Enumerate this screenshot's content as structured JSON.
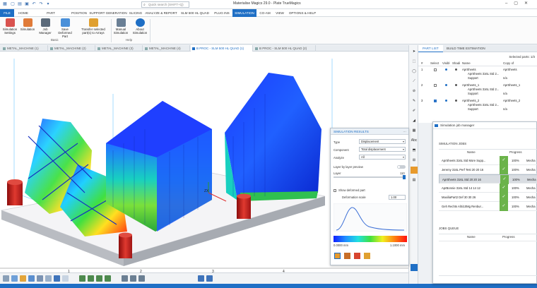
{
  "window": {
    "title": "Materialise Magics 29.0 - Plate TrueMagics",
    "search_placeholder": "Quick search (SHIFT+Q)"
  },
  "ribbon_tabs": [
    "FILE",
    "HOME",
    "PART REPRESENTATION",
    "POSITION",
    "SUPPORT GENERATION",
    "SLICING",
    "ANALYZE & REPORT",
    "SLM 500 HL QUAD",
    "PLUG INS",
    "SIMULATION",
    "CO-AM",
    "VIEW",
    "OPTIONS & HELP"
  ],
  "ribbon_active": "SIMULATION",
  "ribbon": {
    "buttons": [
      {
        "label": "Simulation Settings",
        "icon": "settings-icon",
        "color": "#d9534f"
      },
      {
        "label": "Simulation",
        "icon": "simulation-cube-icon",
        "color": "#e07b39"
      },
      {
        "label": "Job Manager",
        "icon": "job-manager-icon",
        "color": "#5b6a7a"
      },
      {
        "label": "Save Deformed Part",
        "icon": "save-deformed-icon",
        "color": "#4a90d9"
      },
      {
        "label": "Transfer selected part(s) to Arrays",
        "icon": "transfer-icon",
        "color": "#e0a030"
      },
      {
        "label": "Manual Simulation",
        "icon": "manual-icon",
        "color": "#6a7f95"
      },
      {
        "label": "About Simulation",
        "icon": "info-icon",
        "color": "#1f6fc5"
      }
    ],
    "groups": [
      "Basic",
      "Help"
    ]
  },
  "doc_tabs": [
    "METAL_MACHINE (1)",
    "METAL_MACHINE (2)",
    "METAL_MACHINE (3)",
    "METAL_MACHINE (4)",
    "B PROC - SLM 500 HL QUAD (1)",
    "B PROC - SLM 500 HL QUAD (2)"
  ],
  "doc_tab_active": 4,
  "part_panel": {
    "tabs": [
      "PART LIST",
      "BUILD TIME ESTIMATION"
    ],
    "selected_parts": "Selected parts: 1/3",
    "headers": [
      "#",
      "Select",
      "Visibl",
      "Shadi",
      "Name",
      "Copy of"
    ],
    "rows": [
      {
        "num": "1",
        "selected": false,
        "name": "AprSheets",
        "sub": "AprSheets 316L Std 2...",
        "sub2": "Support",
        "copy": "AprSheets",
        "copy2": "n/a"
      },
      {
        "num": "2",
        "selected": false,
        "name": "AprSheets_1",
        "sub": "AprSheets 316L Std 2...",
        "sub2": "Support",
        "copy": "AprSheets_1",
        "copy2": "n/a"
      },
      {
        "num": "3",
        "selected": true,
        "name": "AprSheets_2",
        "sub": "AprSheets 316L Std 2...",
        "sub2": "Support",
        "copy": "AprSheets_2",
        "copy2": "n/a"
      }
    ]
  },
  "sim_results": {
    "title": "SIMULATION RESULTS",
    "type_label": "Type",
    "type_value": "Displacement",
    "component_label": "Component",
    "component_value": "Total displacement",
    "analyze_label": "Analyze",
    "analyze_value": "All",
    "layer_preview_label": "Layer by layer preview",
    "layer_label": "Layer",
    "layer_value": "110",
    "show_deformed_label": "Show deformed part",
    "deformation_scale_label": "Deformation scale",
    "deformation_scale_value": "1.00",
    "scale_min": "0.0000 mm",
    "scale_max": "1.1000 mm"
  },
  "job_manager": {
    "title": "Simulation job manager",
    "jobs_label": "SIMULATION JOBS",
    "queue_label": "JOBS QUEUE",
    "col_name": "Name",
    "col_progress": "Progress",
    "jobs": [
      {
        "name": "AprSheets 316L Std More Supp...",
        "progress": "100%",
        "machine": "Mecha"
      },
      {
        "name": "Jeremy 316L Perf Test 20 20 16",
        "progress": "100%",
        "machine": "Mecha"
      },
      {
        "name": "AprSheets 316L Std 20 20 16",
        "progress": "100%",
        "machine": "Mecha"
      },
      {
        "name": "AprBonnie 316L Std 14 14 12",
        "progress": "100%",
        "machine": "Mecha"
      },
      {
        "name": "MaxiliaPart2 Def 30 30 26",
        "progress": "100%",
        "machine": "Mecha"
      },
      {
        "name": "Geh Rechts AlSi10Mg Renbur...",
        "progress": "100%",
        "machine": "Mecha"
      }
    ],
    "selected_job": 2
  },
  "viewport": {
    "ruler": [
      "1",
      "2",
      "3",
      "4"
    ],
    "axis_label": "ZX"
  },
  "colors": {
    "accent": "#1f6fc5",
    "done": "#6bb34a",
    "plate": "#e8e8ea"
  }
}
